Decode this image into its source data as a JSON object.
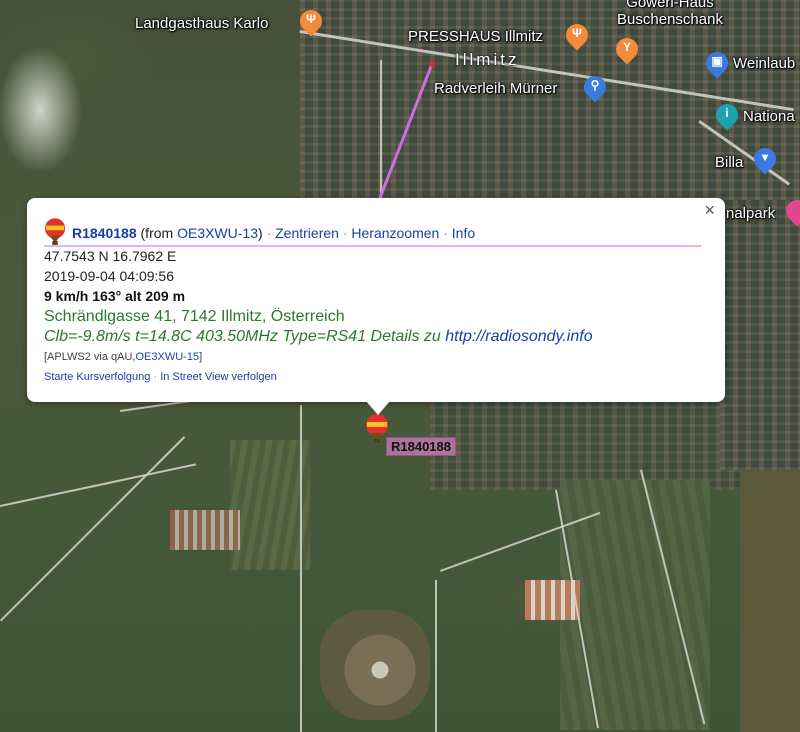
{
  "map": {
    "places": [
      {
        "name": "Landgasthaus Karlo",
        "icon": "restaurant-icon"
      },
      {
        "name": "PRESSHAUS Illmitz",
        "icon": "restaurant-icon"
      },
      {
        "name": "Gowerl-Haus Buschenschank",
        "icon": "bar-icon"
      },
      {
        "name": "Radverleih Mürner",
        "icon": "bicycle-icon"
      },
      {
        "name": "Weinlaub",
        "icon": "shopping-icon"
      },
      {
        "name": "Nationa",
        "icon": "info-icon"
      },
      {
        "name": "Billa",
        "icon": "supermarket-icon"
      },
      {
        "name": "nalpark",
        "icon": "park-icon"
      }
    ],
    "town_name": "Illmitz",
    "colors": {
      "restaurant": "#f28b3c",
      "shop": "#3b7be0",
      "info": "#1ea2b0",
      "park": "#e3468f",
      "track": "#d16be0"
    }
  },
  "popup": {
    "callsign": "R1840188",
    "from_prefix": "(from ",
    "from_station": "OE3XWU-13",
    "from_suffix": ")",
    "actions": [
      "Zentrieren",
      "Heranzoomen",
      "Info"
    ],
    "separator": "·",
    "position": "47.7543 N 16.7962 E",
    "timestamp": "2019-09-04 04:09:56",
    "motion": "9 km/h 163° alt 209 m",
    "address": "Schrändlgasse 41, 7142 Illmitz, Österreich",
    "comment": "Clb=-9.8m/s t=14.8C 403.50MHz Type=RS41 Details zu ",
    "comment_link": "http://radiosondy.info",
    "path_prefix": "[APLWS2 via qAU,",
    "path_station": "OE3XWU-15",
    "path_suffix": "]",
    "footer_links": [
      "Starte Kursverfolgung",
      "In Street View verfolgen"
    ],
    "close_glyph": "×"
  },
  "marker": {
    "label": "R1840188",
    "icon": "balloon-icon"
  }
}
